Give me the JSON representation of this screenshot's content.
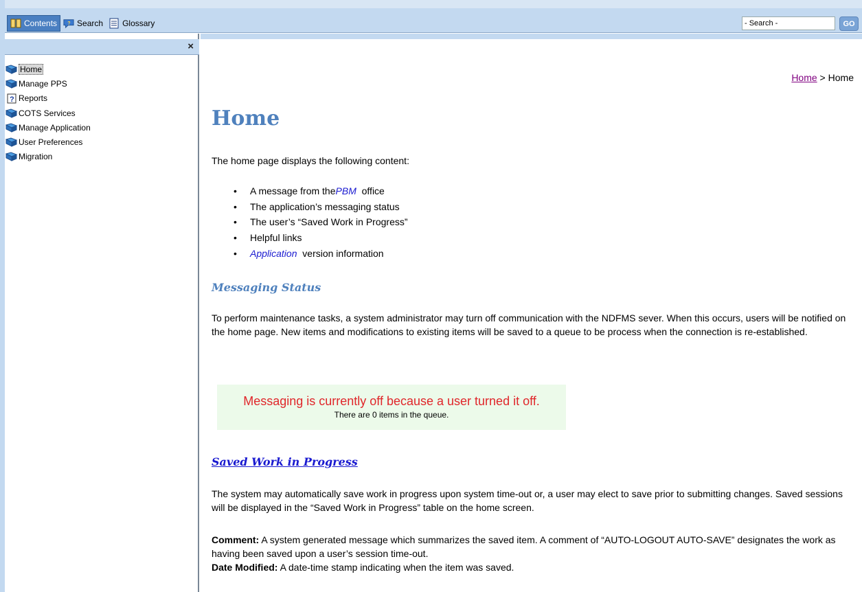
{
  "toolbar": {
    "tabs": [
      {
        "label": "Contents",
        "icon": "book-icon"
      },
      {
        "label": "Search",
        "icon": "search-bubble-icon"
      },
      {
        "label": "Glossary",
        "icon": "glossary-icon"
      }
    ],
    "search_placeholder": "- Search -",
    "go_label": "GO"
  },
  "sidebar": {
    "close_label": "×",
    "items": [
      {
        "label": "Home",
        "icon": "book-icon",
        "selected": true
      },
      {
        "label": "Manage PPS",
        "icon": "book-icon"
      },
      {
        "label": "Reports",
        "icon": "help-page-icon"
      },
      {
        "label": "COTS Services",
        "icon": "book-icon"
      },
      {
        "label": "Manage Application",
        "icon": "book-icon"
      },
      {
        "label": "User Preferences",
        "icon": "book-icon"
      },
      {
        "label": "Migration",
        "icon": "book-icon"
      }
    ]
  },
  "content": {
    "breadcrumb_link": "Home",
    "breadcrumb_sep": " > ",
    "breadcrumb_current": "Home",
    "title": "Home",
    "intro": "The home page displays the following content:",
    "bullets": [
      {
        "pre": "A message from the ",
        "em": "PBM",
        "post": "  office"
      },
      {
        "pre": "The application’s messaging status",
        "em": "",
        "post": ""
      },
      {
        "pre": "The user’s “Saved Work in Progress”",
        "em": "",
        "post": ""
      },
      {
        "pre": "Helpful links",
        "em": "",
        "post": ""
      },
      {
        "pre": "",
        "em": "Application",
        "post": "  version information"
      }
    ],
    "messaging_heading": "Messaging Status",
    "messaging_para": "To perform maintenance tasks, a system administrator may turn off communication with the NDFMS sever.  When this occurs, users will be notified on the home page.  New items and modifications to existing items will be saved to a queue to be process when the connection is re-established.",
    "messaging_box": {
      "main": "Messaging is currently off because a user turned it off.",
      "sub": "There are 0 items in the queue."
    },
    "saved_heading": "Saved Work in Progress",
    "saved_para": "The system may automatically save work in progress upon system time-out or, a user may elect to save prior to submitting changes.  Saved sessions will be displayed in the “Saved Work in Progress” table on the home screen.",
    "comment_term": "Comment:",
    "comment_text": " A system generated message which summarizes the saved item.  A comment of “AUTO-LOGOUT AUTO-SAVE” designates the work as having been saved upon a user’s session time-out.",
    "date_term": "Date Modified:",
    "date_text": " A date-time stamp indicating when the item was saved."
  },
  "colors": {
    "toolbar_bg": "#c3d9f0",
    "active_tab": "#4a7fc1",
    "heading_blue": "#4f81bd",
    "link_blue": "#1a1ad0",
    "message_red": "#e0262a",
    "message_bg": "#ecfaea"
  }
}
